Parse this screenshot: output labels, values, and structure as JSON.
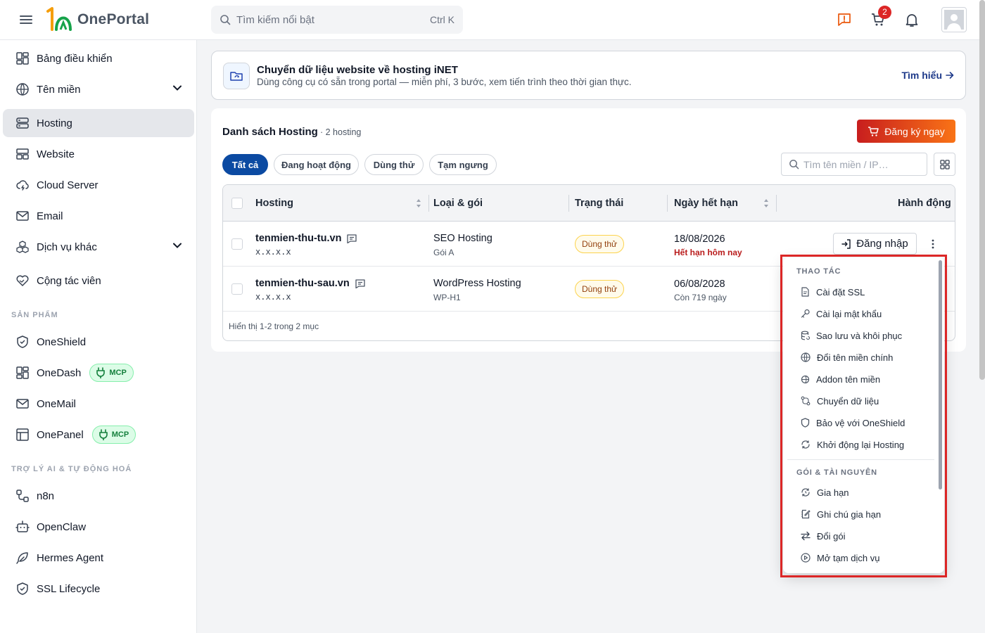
{
  "header": {
    "logo_text": "OnePortal",
    "search_placeholder": "Tìm kiếm nổi bật",
    "search_shortcut": "Ctrl K",
    "cart_count": "2"
  },
  "sidebar": {
    "items": [
      {
        "label": "Bảng điều khiển"
      },
      {
        "label": "Tên miền"
      },
      {
        "label": "Hosting"
      },
      {
        "label": "Website"
      },
      {
        "label": "Cloud Server"
      },
      {
        "label": "Email"
      },
      {
        "label": "Dịch vụ khác"
      },
      {
        "label": "Cộng tác viên"
      }
    ],
    "products_label": "SẢN PHẨM",
    "products": [
      {
        "label": "OneShield"
      },
      {
        "label": "OneDash",
        "badge": "MCP"
      },
      {
        "label": "OneMail"
      },
      {
        "label": "OnePanel",
        "badge": "MCP"
      }
    ],
    "ai_label": "TRỢ LÝ AI & TỰ ĐỘNG HOÁ",
    "ai_items": [
      {
        "label": "n8n"
      },
      {
        "label": "OpenClaw"
      },
      {
        "label": "Hermes Agent"
      },
      {
        "label": "SSL Lifecycle"
      }
    ]
  },
  "banner": {
    "title": "Chuyển dữ liệu website về hosting iNET",
    "subtitle": "Dùng công cụ có sẵn trong portal — miễn phí, 3 bước, xem tiến trình theo thời gian thực.",
    "link": "Tìm hiểu"
  },
  "list": {
    "title": "Danh sách Hosting",
    "count": "· 2 hosting",
    "register_button": "Đăng ký ngay",
    "filters": [
      "Tất cả",
      "Đang hoạt động",
      "Dùng thử",
      "Tạm ngưng"
    ],
    "search_placeholder": "Tìm tên miền / IP…",
    "columns": [
      "Hosting",
      "Loại & gói",
      "Trạng thái",
      "Ngày hết hạn",
      "Hành động"
    ],
    "rows": [
      {
        "domain": "tenmien-thu-tu.vn",
        "ip": "x.x.x.x",
        "type": "SEO Hosting",
        "plan": "Gói A",
        "status": "Dùng thử",
        "expiry": "18/08/2026",
        "expiry_note": "Hết hạn hôm nay"
      },
      {
        "domain": "tenmien-thu-sau.vn",
        "ip": "x.x.x.x",
        "type": "WordPress Hosting",
        "plan": "WP-H1",
        "status": "Dùng thử",
        "expiry": "06/08/2028",
        "expiry_note": "Còn 719 ngày"
      }
    ],
    "login_button": "Đăng nhập",
    "footer": "Hiển thị 1-2 trong 2 mục"
  },
  "menu": {
    "section_actions": "THAO TÁC",
    "actions": [
      "Cài đặt SSL",
      "Cài lại mật khẩu",
      "Sao lưu và khôi phục",
      "Đổi tên miền chính",
      "Addon tên miền",
      "Chuyển dữ liệu",
      "Bảo vệ với OneShield",
      "Khởi động lại Hosting"
    ],
    "section_plan": "GÓI & TÀI NGUYÊN",
    "plan_actions": [
      "Gia hạn",
      "Ghi chú gia hạn",
      "Đổi gói",
      "Mở tạm dịch vụ"
    ]
  },
  "colors": {
    "primary": "#0b4aa2",
    "danger": "#dc2626",
    "accent_orange": "#f97316",
    "mcp_green": "#15803d"
  }
}
